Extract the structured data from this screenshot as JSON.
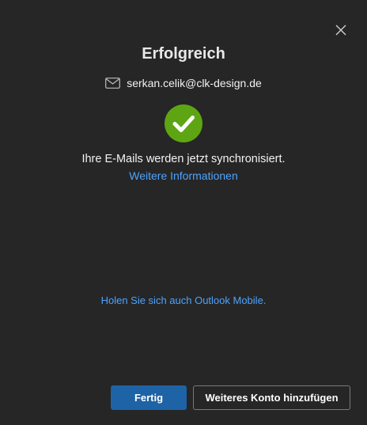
{
  "dialog": {
    "title": "Erfolgreich",
    "account_email": "serkan.celik@clk-design.de",
    "message": "Ihre E-Mails werden jetzt synchronisiert.",
    "more_info_link": "Weitere Informationen",
    "mobile_link": "Holen Sie sich auch Outlook Mobile."
  },
  "buttons": {
    "done_label": "Fertig",
    "add_account_label": "Weiteres Konto hinzufügen"
  },
  "icons": {
    "close": "close-icon",
    "mail": "mail-icon",
    "success": "checkmark-circle-icon"
  },
  "colors": {
    "background": "#262626",
    "success_green": "#5ea513",
    "link_blue": "#4da3ff",
    "primary_button": "#1e63a6"
  }
}
